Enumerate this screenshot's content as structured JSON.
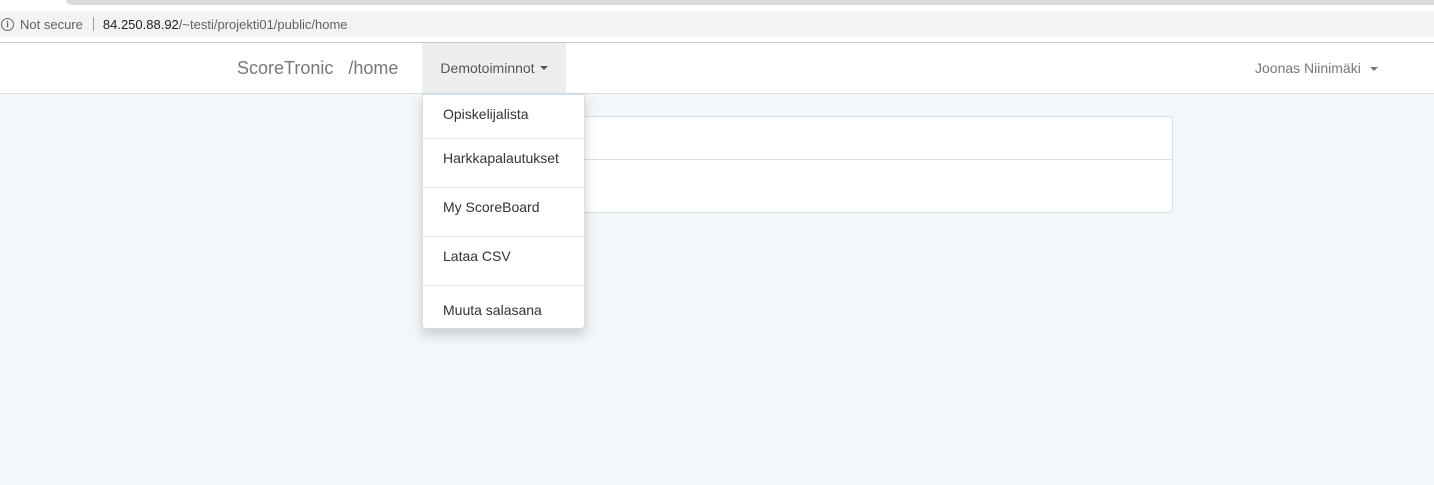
{
  "browser": {
    "security_label": "Not secure",
    "url_host": "84.250.88.92",
    "url_path": "/~testi/projekti01/public/home"
  },
  "navbar": {
    "brand": "ScoreTronic",
    "route": "/home",
    "dropdown_label": "Demotoiminnot",
    "user_name": "Joonas Niinimäki"
  },
  "dropdown_menu": {
    "items": [
      {
        "label": "Opiskelijalista"
      },
      {
        "label": "Harkkapalautukset"
      },
      {
        "label": "My ScoreBoard"
      },
      {
        "label": "Lataa CSV"
      },
      {
        "label": "Muuta salasana"
      }
    ]
  },
  "colors": {
    "page_background": "#f4f7fa",
    "panel_border": "#d3e0e9",
    "active_toggle_bg": "#eeeeee"
  }
}
